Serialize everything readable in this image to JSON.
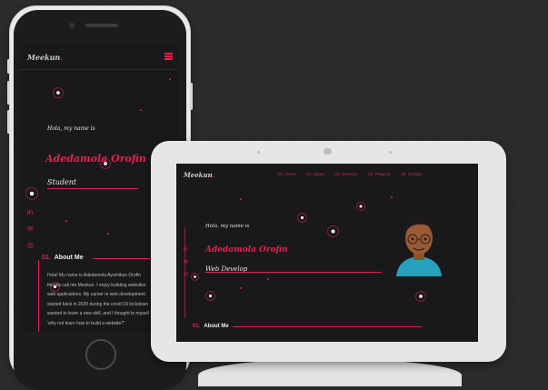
{
  "phone": {
    "logo": "Meekun",
    "greeting": "Hola, my name is",
    "name": "Adedamola Orofin",
    "role": "Student",
    "about": {
      "number": "01.",
      "title": "About Me"
    },
    "about_lines": [
      "Hola! My name is Adedamola Ayomikun Orofin",
      "friends call me Meekun. I enjoy building websites",
      "web applications. My career in web development",
      "started back in 2020 during the covid-19 lockdown",
      "wanted to learn a new skill, and I thought to myself",
      "'why not learn how to build a website?'"
    ]
  },
  "tablet": {
    "logo": "Meekun",
    "nav": [
      {
        "number": "01.",
        "label": "Home"
      },
      {
        "number": "02.",
        "label": "About"
      },
      {
        "number": "03.",
        "label": "Services"
      },
      {
        "number": "04.",
        "label": "Projects"
      },
      {
        "number": "05.",
        "label": "Contact"
      }
    ],
    "greeting": "Hola, my name is",
    "name": "Adedamola Orofin",
    "role": "Web Develop",
    "about": {
      "number": "01.",
      "title": "About Me"
    }
  },
  "colors": {
    "accent": "#e0234e",
    "background": "#19191b",
    "frame": "#e6e6e4"
  },
  "icons": [
    "hamburger-menu-icon",
    "linkedin-icon",
    "twitter-icon",
    "instagram-icon"
  ]
}
